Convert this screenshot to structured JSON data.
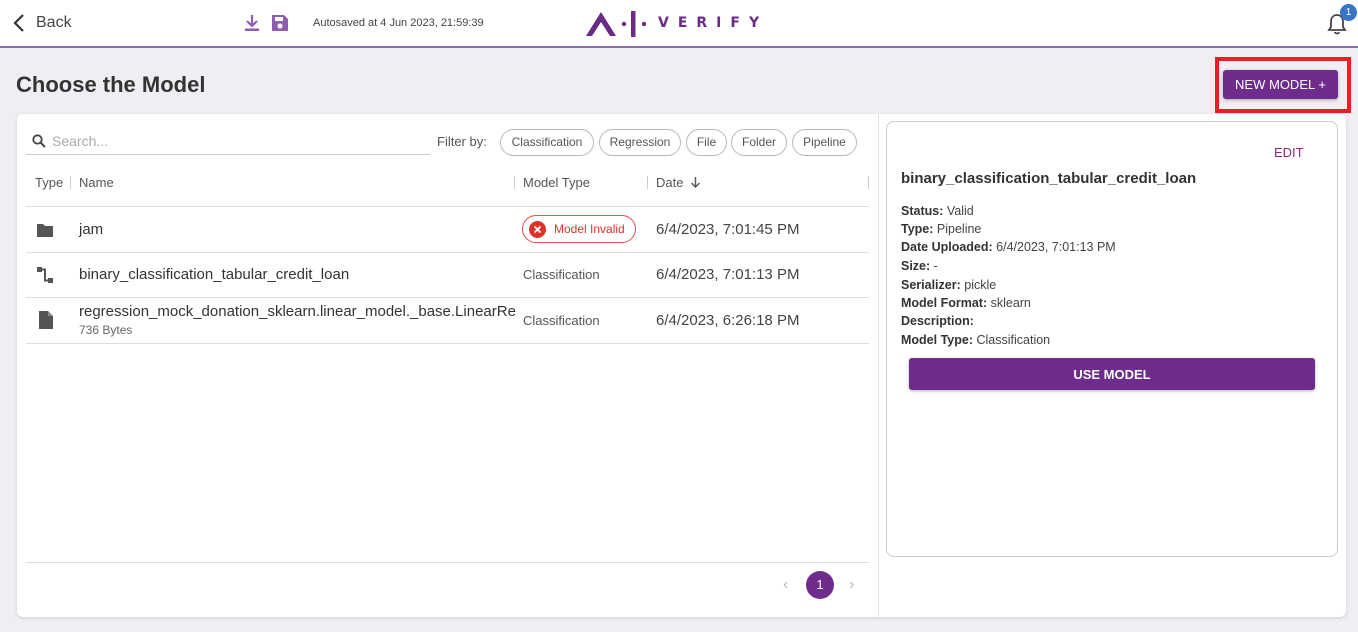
{
  "topbar": {
    "back_label": "Back",
    "autosave_text": "Autosaved at 4 Jun 2023, 21:59:39",
    "logo_text": "VERIFY",
    "notification_count": "1"
  },
  "page": {
    "title": "Choose the Model",
    "new_model_label": "NEW MODEL +"
  },
  "search": {
    "placeholder": "Search..."
  },
  "filters": {
    "label": "Filter by:",
    "chips": [
      "Classification",
      "Regression",
      "File",
      "Folder",
      "Pipeline"
    ]
  },
  "table": {
    "columns": {
      "type": "Type",
      "name": "Name",
      "model_type": "Model Type",
      "date": "Date"
    },
    "rows": [
      {
        "icon": "folder-icon",
        "name": "jam",
        "model_type": "Model Invalid",
        "date": "6/4/2023, 7:01:45 PM"
      },
      {
        "icon": "pipeline-icon",
        "name": "binary_classification_tabular_credit_loan",
        "model_type": "Classification",
        "date": "6/4/2023, 7:01:13 PM"
      },
      {
        "icon": "file-icon",
        "name": "regression_mock_donation_sklearn.linear_model._base.LinearRegression",
        "size": "736 Bytes",
        "model_type": "Classification",
        "date": "6/4/2023, 6:26:18 PM"
      }
    ]
  },
  "pagination": {
    "current": "1",
    "prev": "‹",
    "next": "›"
  },
  "detail": {
    "edit_label": "EDIT",
    "title": "binary_classification_tabular_credit_loan",
    "fields": [
      {
        "label": "Status:",
        "value": "Valid"
      },
      {
        "label": "Type:",
        "value": "Pipeline"
      },
      {
        "label": "Date Uploaded:",
        "value": "6/4/2023, 7:01:13 PM"
      },
      {
        "label": "Size:",
        "value": "-"
      },
      {
        "label": "Serializer:",
        "value": "pickle"
      },
      {
        "label": "Model Format:",
        "value": "sklearn"
      },
      {
        "label": "Description:",
        "value": ""
      },
      {
        "label": "Model Type:",
        "value": "Classification"
      }
    ],
    "use_label": "USE MODEL"
  },
  "colors": {
    "brand": "#6e2c8c",
    "highlight": "#ee1c24",
    "error": "#d9342b",
    "badge": "#3a73c9"
  }
}
